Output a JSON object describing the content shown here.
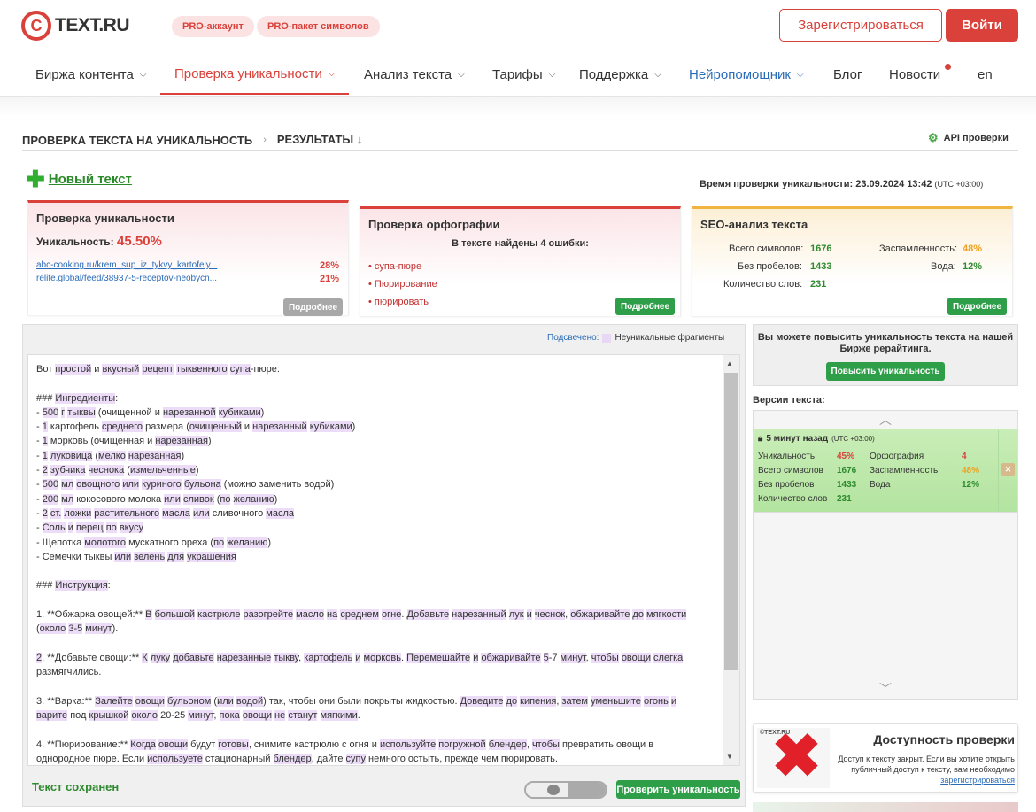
{
  "header": {
    "logo_text": "TEXT.RU",
    "logo_mark": "C",
    "pro_badges": [
      "PRO-аккаунт",
      "PRO-пакет символов"
    ],
    "register_label": "Зарегистрироваться",
    "login_label": "Войти"
  },
  "nav": {
    "items": [
      {
        "label": "Биржа контента"
      },
      {
        "label": "Проверка уникальности"
      },
      {
        "label": "Анализ текста"
      },
      {
        "label": "Тарифы"
      },
      {
        "label": "Поддержка"
      },
      {
        "label": "Нейропомощник"
      },
      {
        "label": "Блог"
      },
      {
        "label": "Новости"
      },
      {
        "label": "en"
      }
    ],
    "active_index": 1,
    "accent_color": "#d9413a",
    "ai_color": "#2a6cb8"
  },
  "breadcrumb": {
    "step1": "ПРОВЕРКА ТЕКСТА НА УНИКАЛЬНОСТЬ",
    "step2": "РЕЗУЛЬТАТЫ",
    "step2_icon": "↓",
    "api_label": "API проверки"
  },
  "new_text_label": "Новый текст",
  "check_time": {
    "label": "Время проверки уникальности: 23.09.2024 13:42",
    "tz": "(UTC +03:00)"
  },
  "uniqueness_card": {
    "title": "Проверка уникальности",
    "uniq_label": "Уникальность:",
    "uniq_value": "45.50%",
    "sources": [
      {
        "url": "abc-cooking.ru/krem_sup_iz_tykvy_kartofely...",
        "percent": "28%"
      },
      {
        "url": "relife.global/feed/38937-5-receptov-neobycn...",
        "percent": "21%"
      }
    ],
    "more_label": "Подробнее"
  },
  "spelling_card": {
    "title": "Проверка орфографии",
    "found": "В тексте найдены 4 ошибки:",
    "errors": [
      "• супа-пюре",
      "• Пюрирование",
      "• пюрировать"
    ],
    "more_label": "Подробнее"
  },
  "seo_card": {
    "title": "SEO-анализ текста",
    "rows": [
      {
        "label": "Всего символов:",
        "value": "1676"
      },
      {
        "label": "Без пробелов:",
        "value": "1433"
      },
      {
        "label": "Количество слов:",
        "value": "231"
      }
    ],
    "rows2": [
      {
        "label": "Заспамленность:",
        "value": "48%"
      },
      {
        "label": "Вода:",
        "value": "12%"
      }
    ],
    "more_label": "Подробнее"
  },
  "text_panel": {
    "legend_key": "Подсвечено:",
    "legend_value": "Неуникальные фрагменты",
    "saved_label": "Текст сохранен",
    "check_button": "Проверить уникальность",
    "lines": [
      [
        [
          "Вот ",
          0
        ],
        [
          "простой",
          1
        ],
        [
          " и ",
          0
        ],
        [
          "вкусный",
          1
        ],
        [
          " ",
          0
        ],
        [
          "рецепт",
          1
        ],
        [
          " ",
          0
        ],
        [
          "тыквенного",
          1
        ],
        [
          " ",
          0
        ],
        [
          "супа",
          1
        ],
        [
          "-пюре:",
          0
        ]
      ],
      [],
      [
        [
          "### ",
          0
        ],
        [
          "Ингредиенты",
          1
        ],
        [
          ":",
          0
        ]
      ],
      [
        [
          "- ",
          0
        ],
        [
          "500",
          1
        ],
        [
          " ",
          0
        ],
        [
          "г",
          1
        ],
        [
          " ",
          0
        ],
        [
          "тыквы",
          1
        ],
        [
          " (очищенной и ",
          0
        ],
        [
          "нарезанной",
          1
        ],
        [
          " ",
          0
        ],
        [
          "кубиками",
          1
        ],
        [
          ")",
          0
        ]
      ],
      [
        [
          "- ",
          0
        ],
        [
          "1",
          1
        ],
        [
          " картофель ",
          0
        ],
        [
          "среднего",
          1
        ],
        [
          " размера (",
          0
        ],
        [
          "очищенный",
          1
        ],
        [
          " и ",
          0
        ],
        [
          "нарезанный",
          1
        ],
        [
          " ",
          0
        ],
        [
          "кубиками",
          1
        ],
        [
          ")",
          0
        ]
      ],
      [
        [
          "- ",
          0
        ],
        [
          "1",
          1
        ],
        [
          " морковь (очищенная и ",
          0
        ],
        [
          "нарезанная",
          1
        ],
        [
          ")",
          0
        ]
      ],
      [
        [
          "- ",
          0
        ],
        [
          "1",
          1
        ],
        [
          " ",
          0
        ],
        [
          "луковица",
          1
        ],
        [
          " (",
          0
        ],
        [
          "мелко",
          1
        ],
        [
          " ",
          0
        ],
        [
          "нарезанная",
          1
        ],
        [
          ")",
          0
        ]
      ],
      [
        [
          "- ",
          0
        ],
        [
          "2",
          1
        ],
        [
          " ",
          0
        ],
        [
          "зубчика",
          1
        ],
        [
          " ",
          0
        ],
        [
          "чеснока",
          1
        ],
        [
          " (",
          0
        ],
        [
          "измельченные",
          1
        ],
        [
          ")",
          0
        ]
      ],
      [
        [
          "- ",
          0
        ],
        [
          "500",
          1
        ],
        [
          " ",
          0
        ],
        [
          "мл",
          1
        ],
        [
          " ",
          0
        ],
        [
          "овощного",
          1
        ],
        [
          " ",
          0
        ],
        [
          "или",
          1
        ],
        [
          " ",
          0
        ],
        [
          "куриного",
          1
        ],
        [
          " ",
          0
        ],
        [
          "бульона",
          1
        ],
        [
          " (можно заменить водой)",
          0
        ]
      ],
      [
        [
          "- ",
          0
        ],
        [
          "200",
          1
        ],
        [
          " ",
          0
        ],
        [
          "мл",
          1
        ],
        [
          " кокосового молока ",
          0
        ],
        [
          "или",
          1
        ],
        [
          " ",
          0
        ],
        [
          "сливок",
          1
        ],
        [
          " (",
          0
        ],
        [
          "по",
          1
        ],
        [
          " ",
          0
        ],
        [
          "желанию",
          1
        ],
        [
          ")",
          0
        ]
      ],
      [
        [
          "- ",
          0
        ],
        [
          "2",
          1
        ],
        [
          " ",
          0
        ],
        [
          "ст.",
          1
        ],
        [
          " ",
          0
        ],
        [
          "ложки",
          1
        ],
        [
          " ",
          0
        ],
        [
          "растительного",
          1
        ],
        [
          " ",
          0
        ],
        [
          "масла",
          1
        ],
        [
          " ",
          0
        ],
        [
          "или",
          1
        ],
        [
          " сливочного ",
          0
        ],
        [
          "масла",
          1
        ]
      ],
      [
        [
          "- ",
          0
        ],
        [
          "Соль",
          1
        ],
        [
          " ",
          0
        ],
        [
          "и",
          1
        ],
        [
          " ",
          0
        ],
        [
          "перец",
          1
        ],
        [
          " ",
          0
        ],
        [
          "по",
          1
        ],
        [
          " ",
          0
        ],
        [
          "вкусу",
          1
        ]
      ],
      [
        [
          "- Щепотка ",
          0
        ],
        [
          "молотого",
          1
        ],
        [
          " мускатного ореха (",
          0
        ],
        [
          "по",
          1
        ],
        [
          " ",
          0
        ],
        [
          "желанию",
          1
        ],
        [
          ")",
          0
        ]
      ],
      [
        [
          "- Семечки тыквы ",
          0
        ],
        [
          "или",
          1
        ],
        [
          " ",
          0
        ],
        [
          "зелень",
          1
        ],
        [
          " ",
          0
        ],
        [
          "для",
          1
        ],
        [
          " ",
          0
        ],
        [
          "украшения",
          1
        ]
      ],
      [],
      [
        [
          "### ",
          0
        ],
        [
          "Инструкция",
          1
        ],
        [
          ":",
          0
        ]
      ],
      [],
      [
        [
          "1. **Обжарка овощей:** ",
          0
        ],
        [
          "В",
          1
        ],
        [
          " ",
          0
        ],
        [
          "большой",
          1
        ],
        [
          " ",
          0
        ],
        [
          "кастрюле",
          1
        ],
        [
          " ",
          0
        ],
        [
          "разогрейте",
          1
        ],
        [
          " ",
          0
        ],
        [
          "масло",
          1
        ],
        [
          " ",
          0
        ],
        [
          "на",
          1
        ],
        [
          " ",
          0
        ],
        [
          "среднем",
          1
        ],
        [
          " ",
          0
        ],
        [
          "огне",
          1
        ],
        [
          ". ",
          0
        ],
        [
          "Добавьте",
          1
        ],
        [
          " ",
          0
        ],
        [
          "нарезанный",
          1
        ],
        [
          " ",
          0
        ],
        [
          "лук",
          1
        ],
        [
          " ",
          0
        ],
        [
          "и",
          1
        ],
        [
          " ",
          0
        ],
        [
          "чеснок",
          1
        ],
        [
          ", ",
          0
        ],
        [
          "обжаривайте",
          1
        ],
        [
          " ",
          0
        ],
        [
          "до",
          1
        ],
        [
          " ",
          0
        ],
        [
          "мягкости",
          1
        ]
      ],
      [
        [
          "(",
          0
        ],
        [
          "около",
          1
        ],
        [
          " ",
          0
        ],
        [
          "3-5",
          1
        ],
        [
          " ",
          0
        ],
        [
          "минут",
          1
        ],
        [
          ").",
          0
        ]
      ],
      [],
      [
        [
          "2",
          1
        ],
        [
          ". **Добавьте овощи:** ",
          0
        ],
        [
          "К",
          1
        ],
        [
          " ",
          0
        ],
        [
          "луку",
          1
        ],
        [
          " ",
          0
        ],
        [
          "добавьте",
          1
        ],
        [
          " ",
          0
        ],
        [
          "нарезанные",
          1
        ],
        [
          " ",
          0
        ],
        [
          "тыкву",
          1
        ],
        [
          ", ",
          0
        ],
        [
          "картофель",
          1
        ],
        [
          " ",
          0
        ],
        [
          "и",
          1
        ],
        [
          " ",
          0
        ],
        [
          "морковь",
          1
        ],
        [
          ". ",
          0
        ],
        [
          "Перемешайте",
          1
        ],
        [
          " ",
          0
        ],
        [
          "и",
          1
        ],
        [
          " ",
          0
        ],
        [
          "обжаривайте",
          1
        ],
        [
          " ",
          0
        ],
        [
          "5",
          1
        ],
        [
          "-7 ",
          0
        ],
        [
          "минут",
          1
        ],
        [
          ", ",
          0
        ],
        [
          "чтобы",
          1
        ],
        [
          " ",
          0
        ],
        [
          "овощи",
          1
        ],
        [
          " ",
          0
        ],
        [
          "слегка",
          1
        ]
      ],
      [
        [
          "размягчились.",
          0
        ]
      ],
      [],
      [
        [
          "3. **Варка:** ",
          0
        ],
        [
          "Залейте",
          1
        ],
        [
          " ",
          0
        ],
        [
          "овощи",
          1
        ],
        [
          " ",
          0
        ],
        [
          "бульоном",
          1
        ],
        [
          " (",
          0
        ],
        [
          "или",
          1
        ],
        [
          " ",
          0
        ],
        [
          "водой",
          1
        ],
        [
          ") так, чтобы они были покрыты жидкостью. ",
          0
        ],
        [
          "Доведите",
          1
        ],
        [
          " ",
          0
        ],
        [
          "до",
          1
        ],
        [
          " ",
          0
        ],
        [
          "кипения",
          1
        ],
        [
          ", ",
          0
        ],
        [
          "затем",
          1
        ],
        [
          " ",
          0
        ],
        [
          "уменьшите",
          1
        ],
        [
          " ",
          0
        ],
        [
          "огонь",
          1
        ],
        [
          " ",
          0
        ],
        [
          "и",
          1
        ]
      ],
      [
        [
          "варите",
          1
        ],
        [
          " под ",
          0
        ],
        [
          "крышкой",
          1
        ],
        [
          " ",
          0
        ],
        [
          "около",
          1
        ],
        [
          " 20-25 ",
          0
        ],
        [
          "минут",
          1
        ],
        [
          ", ",
          0
        ],
        [
          "пока",
          1
        ],
        [
          " ",
          0
        ],
        [
          "овощи",
          1
        ],
        [
          " ",
          0
        ],
        [
          "не",
          1
        ],
        [
          " ",
          0
        ],
        [
          "станут",
          1
        ],
        [
          " ",
          0
        ],
        [
          "мягкими",
          1
        ],
        [
          ".",
          0
        ]
      ],
      [],
      [
        [
          "4. **Пюрирование:** ",
          0
        ],
        [
          "Когда",
          1
        ],
        [
          " ",
          0
        ],
        [
          "овощи",
          1
        ],
        [
          " будут ",
          0
        ],
        [
          "готовы",
          1
        ],
        [
          ", снимите кастрюлю с огня и ",
          0
        ],
        [
          "используйте",
          1
        ],
        [
          " ",
          0
        ],
        [
          "погружной",
          1
        ],
        [
          " ",
          0
        ],
        [
          "блендер",
          1
        ],
        [
          ", ",
          0
        ],
        [
          "чтобы",
          1
        ],
        [
          " превратить овощи в",
          0
        ]
      ],
      [
        [
          "однородное пюре. Если ",
          0
        ],
        [
          "используете",
          1
        ],
        [
          " стационарный ",
          0
        ],
        [
          "блендер",
          1
        ],
        [
          ", дайте ",
          0
        ],
        [
          "супу",
          1
        ],
        [
          " немного остыть, прежде чем пюрировать.",
          0
        ]
      ]
    ]
  },
  "promo": {
    "text": "Вы можете повысить уникальность текста на нашей Бирже рерайтинга.",
    "button": "Повысить уникальность"
  },
  "versions": {
    "title": "Версии текста:",
    "card_title": "5 минут назад",
    "card_tz": "(UTC +03:00)",
    "rows": [
      {
        "k1": "Уникальность",
        "v1": "45%",
        "k2": "Орфография",
        "v2": "4"
      },
      {
        "k1": "Всего символов",
        "v1": "1676",
        "k2": "Заспамленность",
        "v2": "48%"
      },
      {
        "k1": "Без пробелов",
        "v1": "1433",
        "k2": "Вода",
        "v2": "12%"
      },
      {
        "k1": "Количество слов",
        "v1": "231",
        "k2": "",
        "v2": ""
      }
    ]
  },
  "access": {
    "title": "Доступность проверки",
    "desc": "Доступ к тексту закрыт. Если вы хотите открыть публичный доступ к тексту, вам необходимо",
    "link": "зарегистрироваться",
    "logo_text": "©TEXT.RU"
  }
}
